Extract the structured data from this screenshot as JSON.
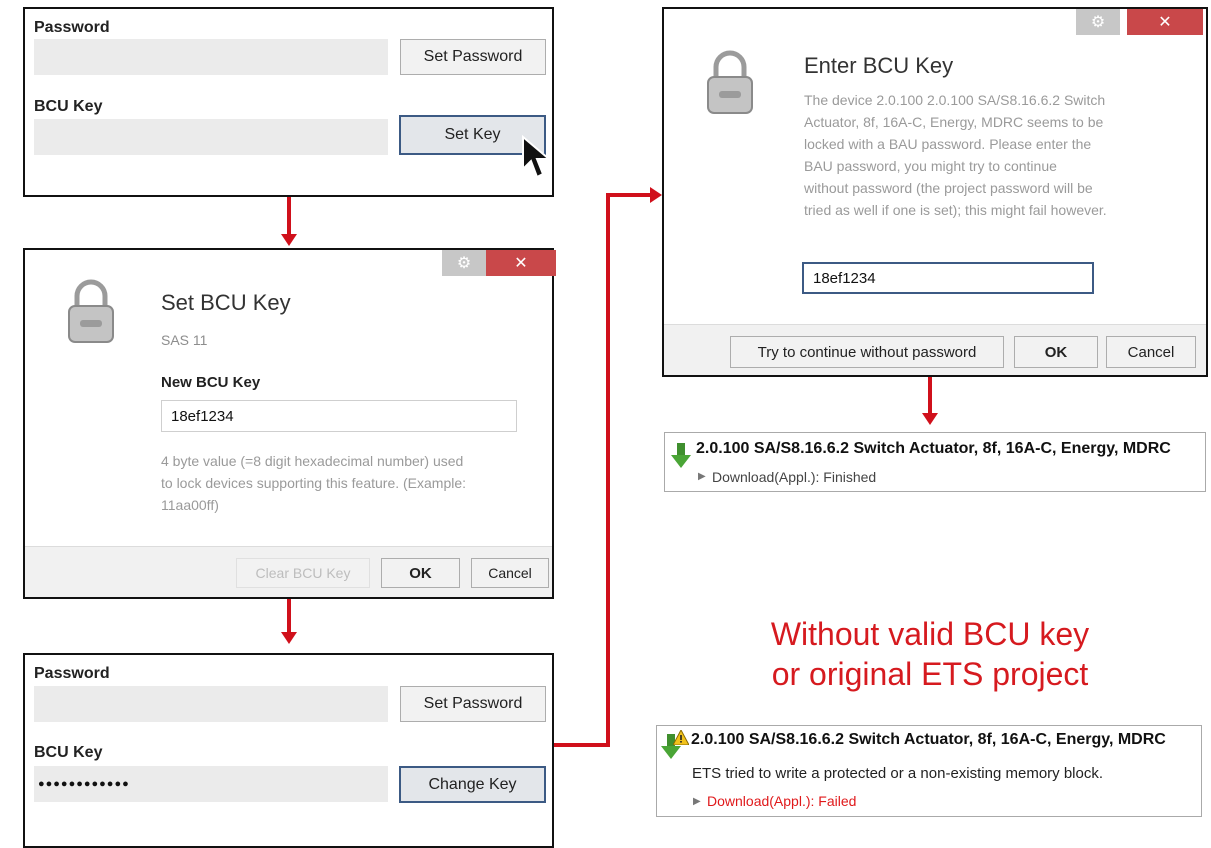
{
  "panel1": {
    "password_label": "Password",
    "set_password_btn": "Set Password",
    "bcu_label": "BCU Key",
    "set_key_btn": "Set Key"
  },
  "set_dialog": {
    "title": "Set BCU Key",
    "subtitle": "SAS 11",
    "field_label": "New BCU Key",
    "field_value": "18ef1234",
    "help_line1": "4 byte value (=8 digit hexadecimal number) used",
    "help_line2": "to lock devices supporting this feature. (Example:",
    "help_line3": "11aa00ff)",
    "clear_btn": "Clear BCU Key",
    "ok_btn": "OK",
    "cancel_btn": "Cancel",
    "gear": "⚙",
    "close": "✕"
  },
  "panel3": {
    "password_label": "Password",
    "set_password_btn": "Set Password",
    "bcu_label": "BCU Key",
    "masked_value": "●●●●●●●●●●●●",
    "change_key_btn": "Change Key"
  },
  "enter_dialog": {
    "title": "Enter BCU Key",
    "msg_lines": [
      "The device 2.0.100 2.0.100 SA/S8.16.6.2 Switch",
      "Actuator, 8f, 16A-C, Energy, MDRC seems to be",
      "locked with a BAU password. Please enter the",
      "BAU password, you might try to continue",
      "without password (the project password will be",
      "tried as well if one is set); this might fail however."
    ],
    "field_value": "18ef1234",
    "try_btn": "Try to continue without password",
    "ok_btn": "OK",
    "cancel_btn": "Cancel",
    "gear": "⚙",
    "close": "✕"
  },
  "status_ok": {
    "device": "2.0.100 SA/S8.16.6.2 Switch Actuator, 8f, 16A-C, Energy, MDRC",
    "line": "Download(Appl.): Finished"
  },
  "heading": {
    "line1": "Without valid BCU key",
    "line2": "or original ETS project"
  },
  "status_fail": {
    "device": "2.0.100 SA/S8.16.6.2 Switch Actuator, 8f, 16A-C, Energy, MDRC",
    "message": "ETS tried to write a protected or a non-existing memory block.",
    "line": "Download(Appl.): Failed"
  },
  "colors": {
    "accent_red": "#d0101b",
    "heading_red": "#d61a1f",
    "close_red": "#c9484a"
  },
  "icons": [
    "lock-icon",
    "download-arrow-icon",
    "warning-icon",
    "mouse-cursor-icon"
  ]
}
